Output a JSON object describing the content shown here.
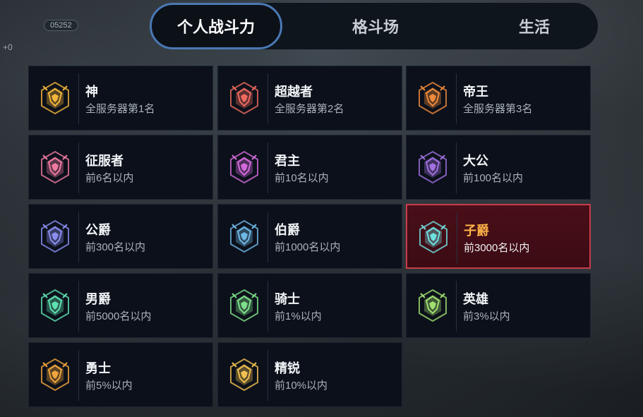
{
  "hud": {
    "badge": "05252",
    "plus": "+0"
  },
  "tabs": [
    {
      "label": "个人战斗力",
      "active": true
    },
    {
      "label": "格斗场",
      "active": false
    },
    {
      "label": "生活",
      "active": false
    }
  ],
  "ranks": [
    {
      "title": "神",
      "sub": "全服务器第1名",
      "icon": "crown-god-icon",
      "color": "#f2b53a"
    },
    {
      "title": "超越者",
      "sub": "全服务器第2名",
      "icon": "transcendent-icon",
      "color": "#f06a5f"
    },
    {
      "title": "帝王",
      "sub": "全服务器第3名",
      "icon": "emperor-icon",
      "color": "#f08a3c"
    },
    {
      "title": "征服者",
      "sub": "前6名以内",
      "icon": "conqueror-icon",
      "color": "#f07aa0"
    },
    {
      "title": "君主",
      "sub": "前10名以内",
      "icon": "monarch-icon",
      "color": "#d46bdc"
    },
    {
      "title": "大公",
      "sub": "前100名以内",
      "icon": "archduke-icon",
      "color": "#a070e0"
    },
    {
      "title": "公爵",
      "sub": "前300名以内",
      "icon": "duke-icon",
      "color": "#8a8ef0"
    },
    {
      "title": "伯爵",
      "sub": "前1000名以内",
      "icon": "count-icon",
      "color": "#6fb8e6"
    },
    {
      "title": "子爵",
      "sub": "前3000名以内",
      "icon": "viscount-icon",
      "color": "#6fe0e0",
      "selected": true
    },
    {
      "title": "男爵",
      "sub": "前5000名以内",
      "icon": "baron-icon",
      "color": "#5ee0b0"
    },
    {
      "title": "骑士",
      "sub": "前1%以内",
      "icon": "knight-icon",
      "color": "#7ee08a"
    },
    {
      "title": "英雄",
      "sub": "前3%以内",
      "icon": "hero-icon",
      "color": "#a0e070"
    },
    {
      "title": "勇士",
      "sub": "前5%以内",
      "icon": "warrior-icon",
      "color": "#f0a43c"
    },
    {
      "title": "精锐",
      "sub": "前10%以内",
      "icon": "elite-icon",
      "color": "#f0c050"
    }
  ]
}
